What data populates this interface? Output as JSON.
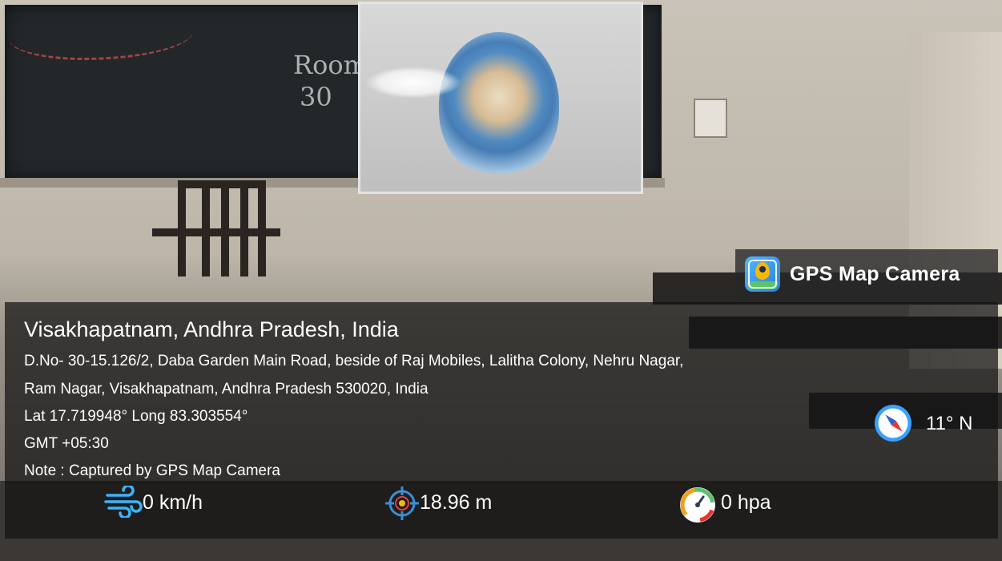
{
  "photo": {
    "board_text": [
      "Room",
      "30"
    ]
  },
  "app_badge": {
    "icon": "gps-map-camera-app-icon",
    "label": "GPS Map Camera"
  },
  "location": {
    "title": "Visakhapatnam, Andhra Pradesh, India",
    "address_line1": "D.No- 30-15.126/2, Daba Garden Main Road, beside of Raj Mobiles, Lalitha Colony, Nehru Nagar,",
    "address_line2": "Ram Nagar, Visakhapatnam, Andhra Pradesh 530020, India",
    "coords": "Lat 17.719948° Long 83.303554°",
    "timezone": "GMT +05:30",
    "note": "Note : Captured by GPS Map Camera"
  },
  "compass": {
    "icon": "compass-icon",
    "value": "11° N"
  },
  "stats": {
    "wind": {
      "icon": "wind-icon",
      "value": "0 km/h"
    },
    "altitude": {
      "icon": "target-icon",
      "value": "18.96 m"
    },
    "pressure": {
      "icon": "gauge-icon",
      "value": "0 hpa"
    }
  },
  "colors": {
    "wind_icon": "#3ab4ff",
    "compass_ring": "#3aa0ff",
    "gauge_ring": "#f0a020"
  }
}
